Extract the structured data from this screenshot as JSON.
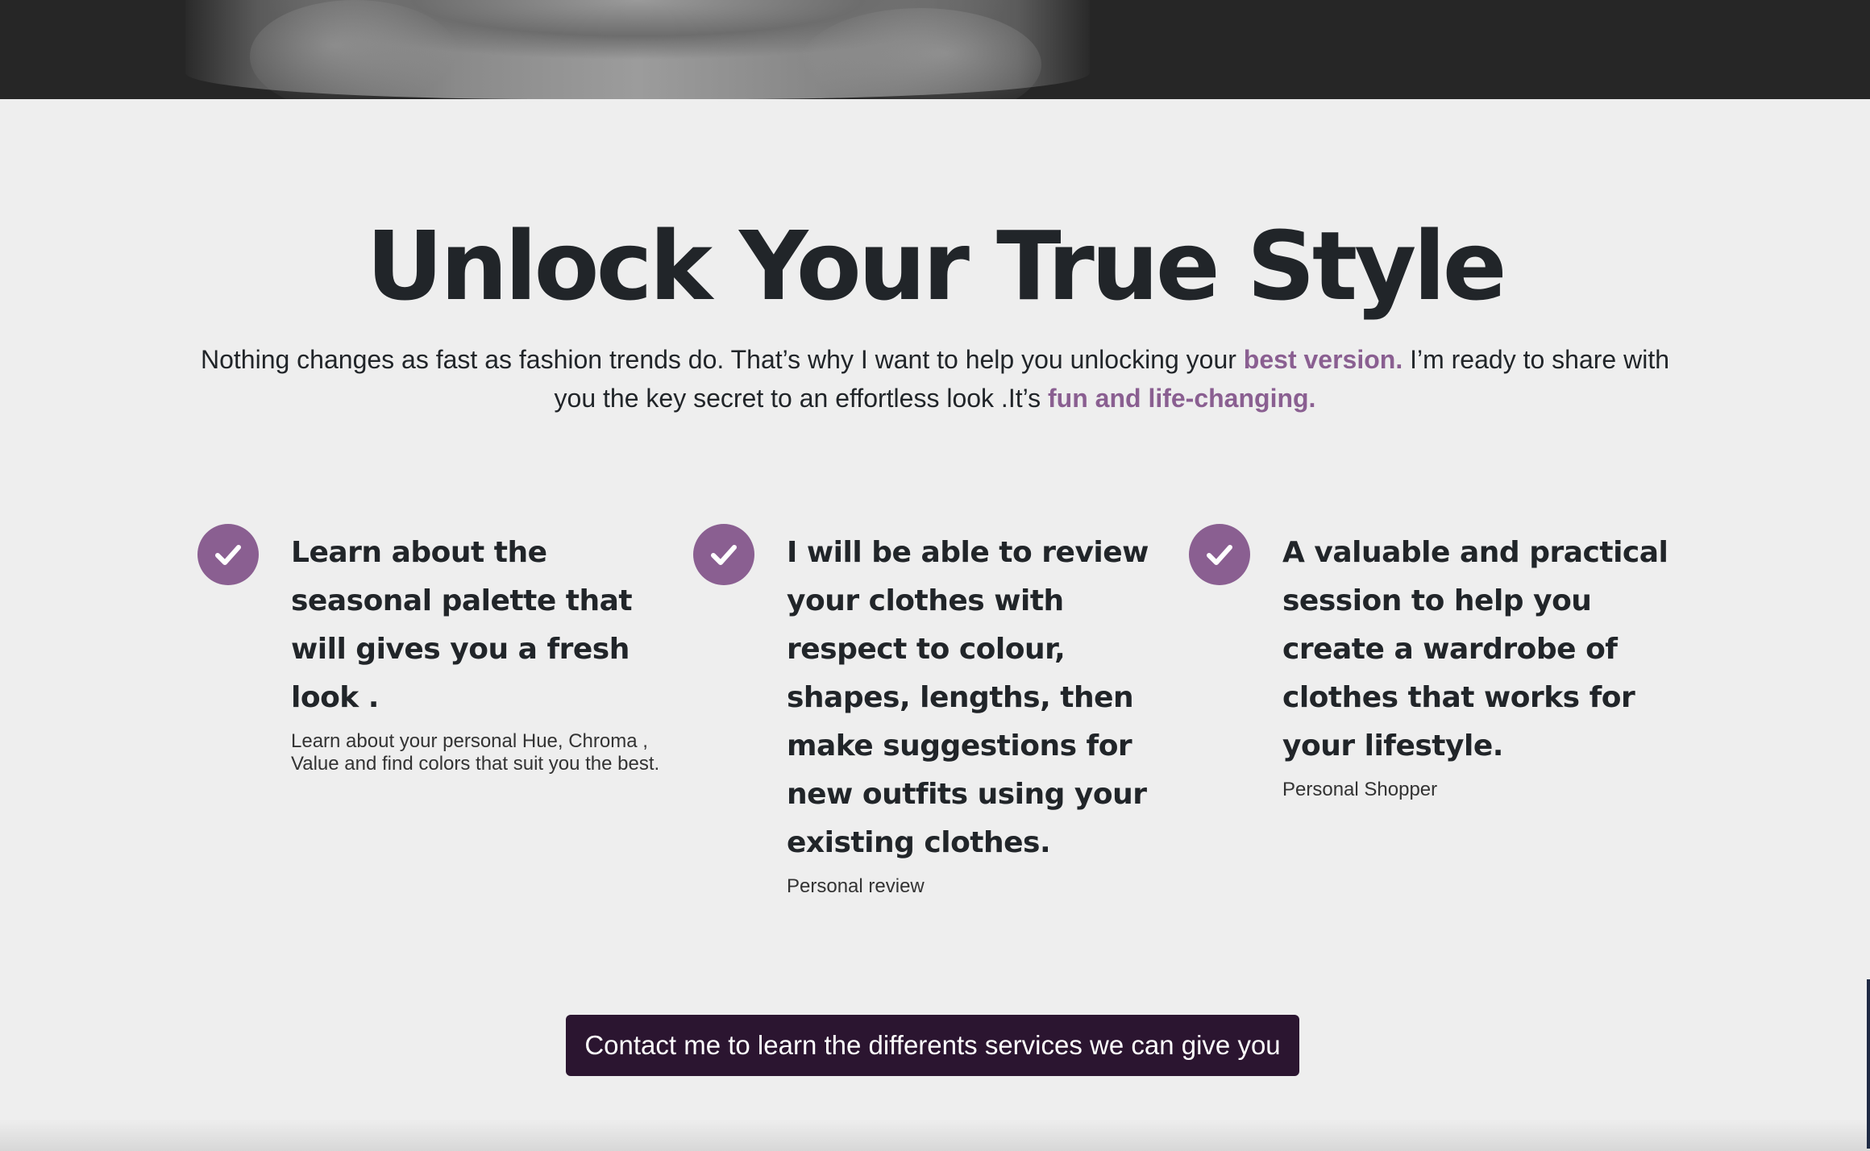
{
  "hero": {
    "image_alt": "portrait photo"
  },
  "headline": "Unlock Your True Style",
  "intro": {
    "part1": "Nothing changes as fast as fashion trends do. That’s why I want to help you unlocking your ",
    "accent1": "best version.",
    "part2": " I’m ready to share with you the key secret to an effortless look .It’s ",
    "accent2": "fun and life-changing."
  },
  "features": [
    {
      "icon": "check-icon",
      "title": "Learn about the seasonal palette that will gives you a fresh look .",
      "description": "Learn about your personal Hue, Chroma , Value and find colors that suit you the best."
    },
    {
      "icon": "check-icon",
      "title": "I will be able to review your clothes with respect to colour, shapes, lengths, then make suggestions for new outfits using your existing clothes.",
      "description": "Personal review"
    },
    {
      "icon": "check-icon",
      "title": "A valuable and practical session to help you create a wardrobe of clothes that works for your lifestyle.",
      "description": "Personal Shopper"
    }
  ],
  "cta": {
    "label": "Contact me to learn the differents services we can give you"
  },
  "colors": {
    "accent": "#8a5f91",
    "button": "#2b1530",
    "background": "#eeeeee",
    "text": "#212529"
  }
}
